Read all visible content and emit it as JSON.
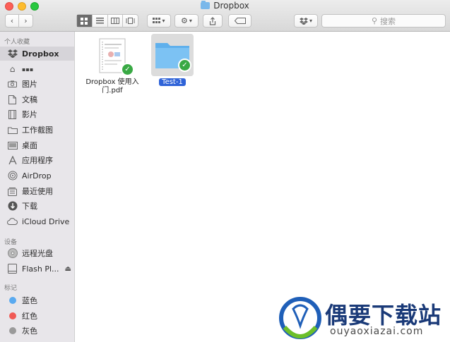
{
  "window": {
    "title": "Dropbox"
  },
  "toolbar": {
    "back_icon": "chevron-left-icon",
    "forward_icon": "chevron-right-icon",
    "view_modes": [
      "icon-view",
      "list-view",
      "column-view",
      "cover-flow-view"
    ],
    "active_view": "icon-view",
    "search_placeholder": "搜索"
  },
  "sidebar": {
    "favorites_header": "个人收藏",
    "favorites": [
      {
        "label": "Dropbox",
        "icon": "dropbox-icon",
        "selected": true
      },
      {
        "label": "▪▪▪",
        "icon": "home-icon",
        "selected": false
      },
      {
        "label": "图片",
        "icon": "camera-icon",
        "selected": false
      },
      {
        "label": "文稿",
        "icon": "document-icon",
        "selected": false
      },
      {
        "label": "影片",
        "icon": "film-icon",
        "selected": false
      },
      {
        "label": "工作截图",
        "icon": "folder-icon",
        "selected": false
      },
      {
        "label": "桌面",
        "icon": "desktop-icon",
        "selected": false
      },
      {
        "label": "应用程序",
        "icon": "apps-icon",
        "selected": false
      },
      {
        "label": "AirDrop",
        "icon": "airdrop-icon",
        "selected": false
      },
      {
        "label": "最近使用",
        "icon": "recents-icon",
        "selected": false
      },
      {
        "label": "下载",
        "icon": "download-icon",
        "selected": false
      },
      {
        "label": "iCloud Drive",
        "icon": "cloud-icon",
        "selected": false
      }
    ],
    "devices_header": "设备",
    "devices": [
      {
        "label": "远程光盘",
        "icon": "disc-icon"
      },
      {
        "label": "Flash Pl...",
        "icon": "drive-icon",
        "eject": "⏏"
      }
    ],
    "tags_header": "标记",
    "tags": [
      {
        "label": "蓝色",
        "color": "#5aaaf0"
      },
      {
        "label": "红色",
        "color": "#f05a55"
      },
      {
        "label": "灰色",
        "color": "#9a9a9a"
      }
    ]
  },
  "files": [
    {
      "label_line1": "Dropbox 使用入",
      "label_line2": "门.pdf",
      "type": "pdf",
      "synced": true
    },
    {
      "label": "Test-1",
      "type": "folder",
      "synced": true,
      "selected": true
    }
  ],
  "watermark": {
    "title": "偶要下载站",
    "url": "ouyaoxiazai.com"
  }
}
